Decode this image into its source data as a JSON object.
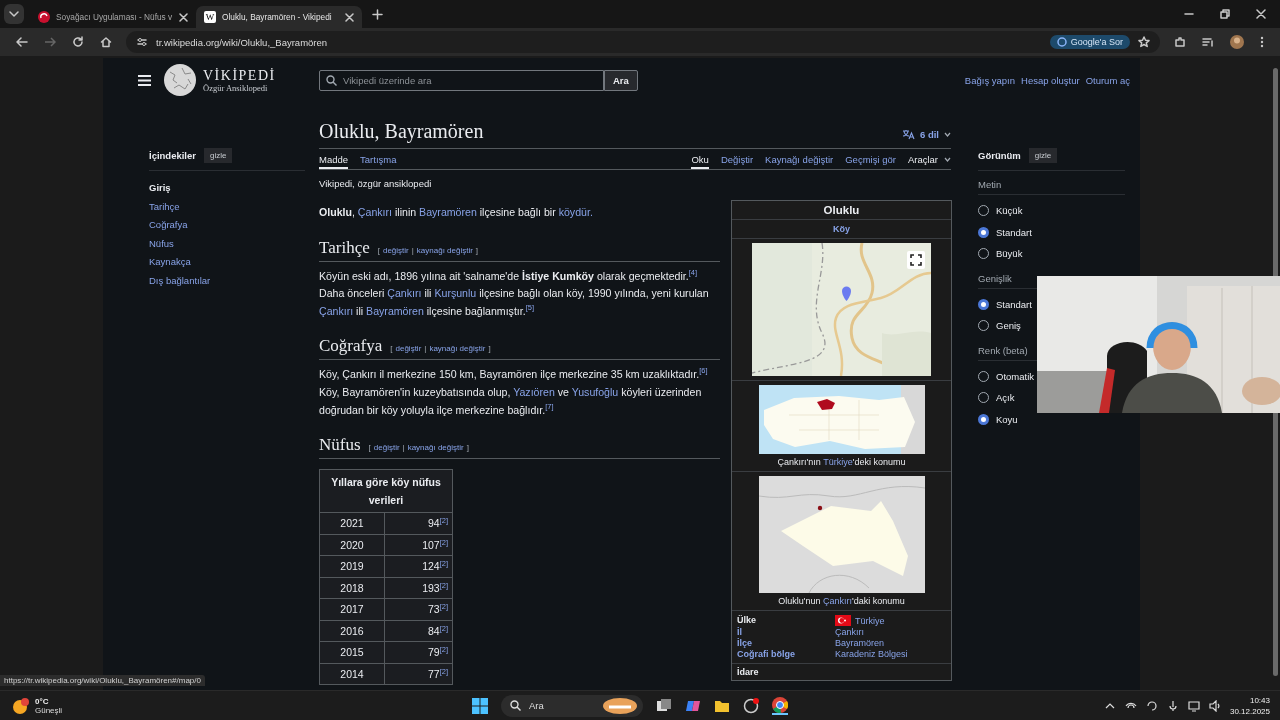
{
  "browser": {
    "tabs": [
      {
        "title": "Soyağacı Uygulaması - Nüfus v",
        "selected": false
      },
      {
        "title": "Oluklu, Bayramören - Vikipedi",
        "selected": true,
        "letter": "W"
      }
    ],
    "address": "tr.wikipedia.org/wiki/Oluklu,_Bayramören",
    "assistant_button": "Google'a Sor"
  },
  "header": {
    "logo_title": "VİKİPEDİ",
    "logo_tagline": "Özgür Ansiklopedi",
    "search_placeholder": "Vikipedi üzerinde ara",
    "search_button": "Ara",
    "user_links": [
      "Bağış yapın",
      "Hesap oluştur",
      "Oturum aç"
    ]
  },
  "toc": {
    "title": "İçindekiler",
    "hide_button": "gizle",
    "items": [
      {
        "label": "Giriş",
        "selected": true
      },
      {
        "label": "Tarihçe",
        "selected": false
      },
      {
        "label": "Coğrafya",
        "selected": false
      },
      {
        "label": "Nüfus",
        "selected": false
      },
      {
        "label": "Kaynakça",
        "selected": false
      },
      {
        "label": "Dış bağlantılar",
        "selected": false
      }
    ]
  },
  "article": {
    "title": "Oluklu, Bayramören",
    "languages": "6 dil",
    "namespace_tabs": [
      {
        "label": "Madde",
        "selected": true
      },
      {
        "label": "Tartışma",
        "selected": false
      }
    ],
    "view_tabs": [
      {
        "label": "Oku",
        "selected": true
      },
      {
        "label": "Değiştir",
        "selected": false
      },
      {
        "label": "Kaynağı değiştir",
        "selected": false
      },
      {
        "label": "Geçmişi gör",
        "selected": false
      }
    ],
    "tools_menu": "Araçlar",
    "tagline": "Vikipedi, özgür ansiklopedi",
    "lead": [
      {
        "kind": "bold",
        "text": "Oluklu"
      },
      {
        "kind": "text",
        "text": ", "
      },
      {
        "kind": "link",
        "text": "Çankırı"
      },
      {
        "kind": "text",
        "text": " ilinin "
      },
      {
        "kind": "link",
        "text": "Bayramören"
      },
      {
        "kind": "text",
        "text": " ilçesine bağlı bir "
      },
      {
        "kind": "link",
        "text": "köydür."
      }
    ],
    "sections": [
      {
        "heading": "Tarihçe",
        "edit_open": "[",
        "edit_links": [
          "değiştir",
          "kaynağı değiştir"
        ],
        "edit_separator": "|",
        "edit_close": "]",
        "paragraph": [
          {
            "kind": "text",
            "text": "Köyün eski adı, 1896 yılına ait 'salname'de "
          },
          {
            "kind": "bold",
            "text": "İstiye Kumköy"
          },
          {
            "kind": "text",
            "text": " olarak geçmektedir."
          },
          {
            "kind": "ref",
            "text": "[4]"
          },
          {
            "kind": "text",
            "text": " Daha önceleri "
          },
          {
            "kind": "link",
            "text": "Çankırı"
          },
          {
            "kind": "text",
            "text": " ili "
          },
          {
            "kind": "link",
            "text": "Kurşunlu"
          },
          {
            "kind": "text",
            "text": " ilçesine bağlı olan köy, 1990 yılında, yeni kurulan "
          },
          {
            "kind": "link",
            "text": "Çankırı"
          },
          {
            "kind": "text",
            "text": " ili "
          },
          {
            "kind": "link",
            "text": "Bayramören"
          },
          {
            "kind": "text",
            "text": " ilçesine bağlanmıştır."
          },
          {
            "kind": "ref",
            "text": "[5]"
          }
        ]
      },
      {
        "heading": "Coğrafya",
        "edit_open": "[",
        "edit_links": [
          "değiştir",
          "kaynağı değiştir"
        ],
        "edit_separator": "|",
        "edit_close": "]",
        "paragraph": [
          {
            "kind": "text",
            "text": "Köy, Çankırı il merkezine 150 km, Bayramören ilçe merkezine 35 km uzaklıktadır."
          },
          {
            "kind": "ref",
            "text": "[6]"
          },
          {
            "kind": "text",
            "text": " Köy, Bayramören'in kuzeybatısında olup, "
          },
          {
            "kind": "link",
            "text": "Yazıören"
          },
          {
            "kind": "text",
            "text": " ve "
          },
          {
            "kind": "link",
            "text": "Yusufoğlu"
          },
          {
            "kind": "text",
            "text": " köyleri üzerinden doğrudan bir köy yoluyla ilçe merkezine bağlıdır."
          },
          {
            "kind": "ref",
            "text": "[7]"
          }
        ]
      },
      {
        "heading": "Nüfus",
        "edit_open": "[",
        "edit_links": [
          "değiştir",
          "kaynağı değiştir"
        ],
        "edit_separator": "|",
        "edit_close": "]"
      }
    ],
    "population_table": {
      "caption": "Yıllara göre köy nüfus verileri",
      "rows": [
        {
          "year": "2021",
          "population": "94",
          "ref": "[2]"
        },
        {
          "year": "2020",
          "population": "107",
          "ref": "[2]"
        },
        {
          "year": "2019",
          "population": "124",
          "ref": "[2]"
        },
        {
          "year": "2018",
          "population": "193",
          "ref": "[2]"
        },
        {
          "year": "2017",
          "population": "73",
          "ref": "[2]"
        },
        {
          "year": "2016",
          "population": "84",
          "ref": "[2]"
        },
        {
          "year": "2015",
          "population": "79",
          "ref": "[2]"
        },
        {
          "year": "2014",
          "population": "77",
          "ref": "[2]"
        }
      ]
    }
  },
  "infobox": {
    "title": "Oluklu",
    "type": "Köy",
    "locator_maps": [
      {
        "caption": [
          {
            "kind": "text",
            "text": "Çankırı'nın "
          },
          {
            "kind": "link",
            "text": "Türkiye"
          },
          {
            "kind": "text",
            "text": "'deki konumu"
          }
        ]
      },
      {
        "caption": [
          {
            "kind": "text",
            "text": "Oluklu'nun "
          },
          {
            "kind": "link",
            "text": "Çankırı"
          },
          {
            "kind": "text",
            "text": "'daki konumu"
          }
        ]
      }
    ],
    "rows": [
      {
        "label": {
          "kind": "text",
          "text": "Ülke"
        },
        "value": "Türkiye",
        "flag": true
      },
      {
        "label": {
          "kind": "link",
          "text": "İl"
        },
        "value": "Çankırı",
        "flag": false
      },
      {
        "label": {
          "kind": "link",
          "text": "İlçe"
        },
        "value": "Bayramören",
        "flag": false
      },
      {
        "label": {
          "kind": "link",
          "text": "Coğrafi bölge"
        },
        "value": "Karadeniz Bölgesi",
        "flag": false
      }
    ],
    "next_heading": "İdare"
  },
  "appearance": {
    "title": "Görünüm",
    "hide_button": "gizle",
    "groups": [
      {
        "label": "Metin",
        "options": [
          {
            "label": "Küçük",
            "selected": false
          },
          {
            "label": "Standart",
            "selected": true
          },
          {
            "label": "Büyük",
            "selected": false
          }
        ]
      },
      {
        "label": "Genişlik",
        "options": [
          {
            "label": "Standart",
            "selected": true
          },
          {
            "label": "Geniş",
            "selected": false
          }
        ]
      },
      {
        "label": "Renk (beta)",
        "options": [
          {
            "label": "Otomatik",
            "selected": false
          },
          {
            "label": "Açık",
            "selected": false
          },
          {
            "label": "Koyu",
            "selected": true
          }
        ]
      }
    ]
  },
  "status_url": "https://tr.wikipedia.org/wiki/Oluklu,_Bayramören#/map/0",
  "taskbar": {
    "temperature": "0°C",
    "weather": "Güneşli",
    "search": "Ara",
    "time": "10:43",
    "date": "30.12.2025"
  }
}
